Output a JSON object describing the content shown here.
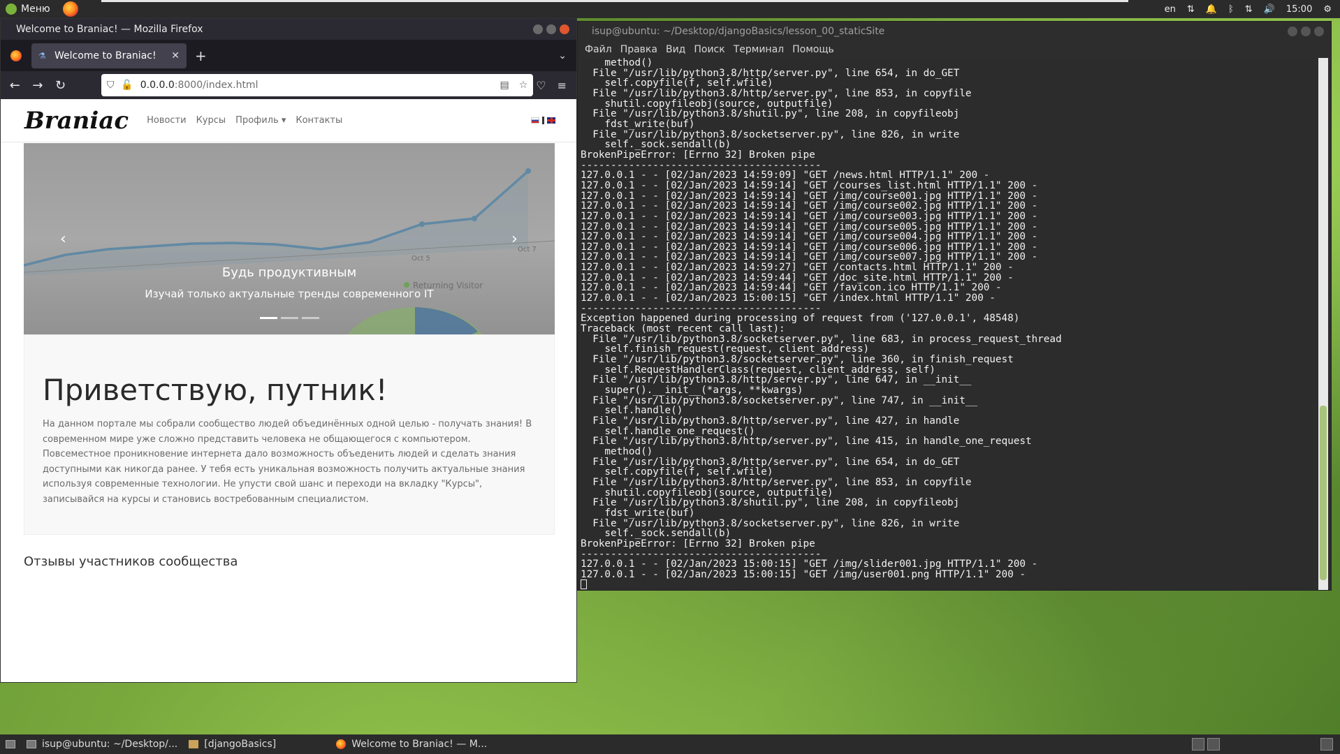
{
  "top_panel": {
    "menu_label": "Меню",
    "keyboard_layout": "en",
    "clock": "15:00"
  },
  "firefox": {
    "window_title": "Welcome to Braniac! — Mozilla Firefox",
    "tab_title": "Welcome to Braniac!",
    "url_host": "0.0.0.0",
    "url_rest": ":8000/index.html",
    "page": {
      "brand": "Braniac",
      "nav": [
        "Новости",
        "Курсы",
        "Профиль ▾",
        "Контакты"
      ],
      "carousel": {
        "title": "Будь продуктивным",
        "subtitle": "Изучай только актуальные тренды современного IT",
        "chart_labels": [
          "Oct 5",
          "Oct 7",
          "Returning Visitor"
        ],
        "prev_icon": "‹",
        "next_icon": "›"
      },
      "jumbotron": {
        "heading": "Приветствую, путник!",
        "text": "На данном портале мы собрали сообщество людей объединённых одной целью - получать знания! В современном мире уже сложно представить человека не общающегося с компьютером. Повсеместное проникновение интернета дало возможность объеденить людей и сделать знания доступными как никогда ранее. У тебя есть уникальная возможность получить актуальные знания используя современные технологии. Не упусти свой шанс и переходи на вкладку \"Курсы\", записывайся на курсы и становись востребованным специалистом."
      },
      "reviews_heading": "Отзывы участников сообщества"
    }
  },
  "terminal": {
    "window_title": "isup@ubuntu: ~/Desktop/djangoBasics/lesson_00_staticSite",
    "menu": [
      "Файл",
      "Правка",
      "Вид",
      "Поиск",
      "Терминал",
      "Помощь"
    ],
    "lines": [
      "    method()",
      "  File \"/usr/lib/python3.8/http/server.py\", line 654, in do_GET",
      "    self.copyfile(f, self.wfile)",
      "  File \"/usr/lib/python3.8/http/server.py\", line 853, in copyfile",
      "    shutil.copyfileobj(source, outputfile)",
      "  File \"/usr/lib/python3.8/shutil.py\", line 208, in copyfileobj",
      "    fdst_write(buf)",
      "  File \"/usr/lib/python3.8/socketserver.py\", line 826, in write",
      "    self._sock.sendall(b)",
      "BrokenPipeError: [Errno 32] Broken pipe",
      "----------------------------------------",
      "127.0.0.1 - - [02/Jan/2023 14:59:09] \"GET /news.html HTTP/1.1\" 200 -",
      "127.0.0.1 - - [02/Jan/2023 14:59:14] \"GET /courses_list.html HTTP/1.1\" 200 -",
      "127.0.0.1 - - [02/Jan/2023 14:59:14] \"GET /img/course001.jpg HTTP/1.1\" 200 -",
      "127.0.0.1 - - [02/Jan/2023 14:59:14] \"GET /img/course002.jpg HTTP/1.1\" 200 -",
      "127.0.0.1 - - [02/Jan/2023 14:59:14] \"GET /img/course003.jpg HTTP/1.1\" 200 -",
      "127.0.0.1 - - [02/Jan/2023 14:59:14] \"GET /img/course005.jpg HTTP/1.1\" 200 -",
      "127.0.0.1 - - [02/Jan/2023 14:59:14] \"GET /img/course004.jpg HTTP/1.1\" 200 -",
      "127.0.0.1 - - [02/Jan/2023 14:59:14] \"GET /img/course006.jpg HTTP/1.1\" 200 -",
      "127.0.0.1 - - [02/Jan/2023 14:59:14] \"GET /img/course007.jpg HTTP/1.1\" 200 -",
      "127.0.0.1 - - [02/Jan/2023 14:59:27] \"GET /contacts.html HTTP/1.1\" 200 -",
      "127.0.0.1 - - [02/Jan/2023 14:59:44] \"GET /doc_site.html HTTP/1.1\" 200 -",
      "127.0.0.1 - - [02/Jan/2023 14:59:44] \"GET /favicon.ico HTTP/1.1\" 200 -",
      "127.0.0.1 - - [02/Jan/2023 15:00:15] \"GET /index.html HTTP/1.1\" 200 -",
      "----------------------------------------",
      "Exception happened during processing of request from ('127.0.0.1', 48548)",
      "Traceback (most recent call last):",
      "  File \"/usr/lib/python3.8/socketserver.py\", line 683, in process_request_thread",
      "    self.finish_request(request, client_address)",
      "  File \"/usr/lib/python3.8/socketserver.py\", line 360, in finish_request",
      "    self.RequestHandlerClass(request, client_address, self)",
      "  File \"/usr/lib/python3.8/http/server.py\", line 647, in __init__",
      "    super().__init__(*args, **kwargs)",
      "  File \"/usr/lib/python3.8/socketserver.py\", line 747, in __init__",
      "    self.handle()",
      "  File \"/usr/lib/python3.8/http/server.py\", line 427, in handle",
      "    self.handle_one_request()",
      "  File \"/usr/lib/python3.8/http/server.py\", line 415, in handle_one_request",
      "    method()",
      "  File \"/usr/lib/python3.8/http/server.py\", line 654, in do_GET",
      "    self.copyfile(f, self.wfile)",
      "  File \"/usr/lib/python3.8/http/server.py\", line 853, in copyfile",
      "    shutil.copyfileobj(source, outputfile)",
      "  File \"/usr/lib/python3.8/shutil.py\", line 208, in copyfileobj",
      "    fdst_write(buf)",
      "  File \"/usr/lib/python3.8/socketserver.py\", line 826, in write",
      "    self._sock.sendall(b)",
      "BrokenPipeError: [Errno 32] Broken pipe",
      "----------------------------------------",
      "127.0.0.1 - - [02/Jan/2023 15:00:15] \"GET /img/slider001.jpg HTTP/1.1\" 200 -",
      "127.0.0.1 - - [02/Jan/2023 15:00:15] \"GET /img/user001.png HTTP/1.1\" 200 -"
    ]
  },
  "taskbar": {
    "items": [
      "isup@ubuntu: ~/Desktop/...",
      "[djangoBasics]",
      "Welcome to Braniac! — M..."
    ]
  }
}
